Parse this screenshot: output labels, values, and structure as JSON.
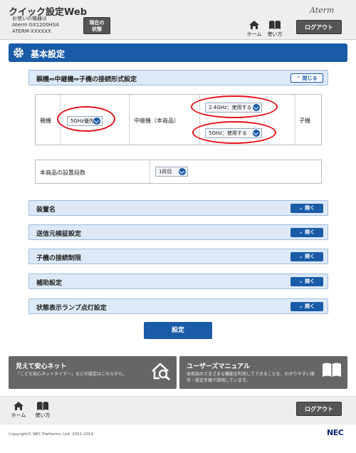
{
  "header": {
    "app_title": "クイック設定Web",
    "device_label": "お使いの機器は",
    "device_model": "Aterm GX1200HS4",
    "device_ssid": "ATERM-XXXXXX",
    "status_line1": "現在の",
    "status_line2": "状態",
    "brand": "Aterm",
    "nav_home": "ホーム",
    "nav_help": "使い方",
    "logout": "ログアウト"
  },
  "section": {
    "title": "基本設定"
  },
  "connection": {
    "header_label": "親機⇔中継機⇔子機の接続形式設定",
    "collapse_label": "閉じる",
    "parent_label": "親機",
    "parent_value": "5GHz優先",
    "repeater_label": "中継機（本商品）",
    "repeater_24_value": "2.4GHz：使用する",
    "repeater_5_value": "5GHz：使用する",
    "child_label": "子機"
  },
  "stage": {
    "label": "本商品の設置段数",
    "value": "1段目"
  },
  "sections": [
    {
      "label": "装置名",
      "button": "開く"
    },
    {
      "label": "送信元検証設定",
      "button": "開く"
    },
    {
      "label": "子機の接続制限",
      "button": "開く"
    },
    {
      "label": "補助設定",
      "button": "開く"
    },
    {
      "label": "状態表示ランプ点灯設定",
      "button": "開く"
    }
  ],
  "submit": "設定",
  "promo": {
    "left_title": "見えて安心ネット",
    "left_desc": "「こども安心ネットタイマー」などの設定はこちらから。",
    "right_title": "ユーザーズマニュアル",
    "right_desc1": "本商品のさまざまな機能を利用してできることを、わかりやすい操",
    "right_desc2": "作・設定手順で説明しています。"
  },
  "footer": {
    "nav_home": "ホーム",
    "nav_help": "使い方",
    "logout": "ログアウト",
    "copyright": "Copyright© NEC Platforms, Ltd. 2001-2019",
    "nec": "NEC"
  },
  "colors": {
    "primary": "#1a5ba8",
    "highlight": "#e3121b",
    "row_bg": "#dde9f6"
  }
}
